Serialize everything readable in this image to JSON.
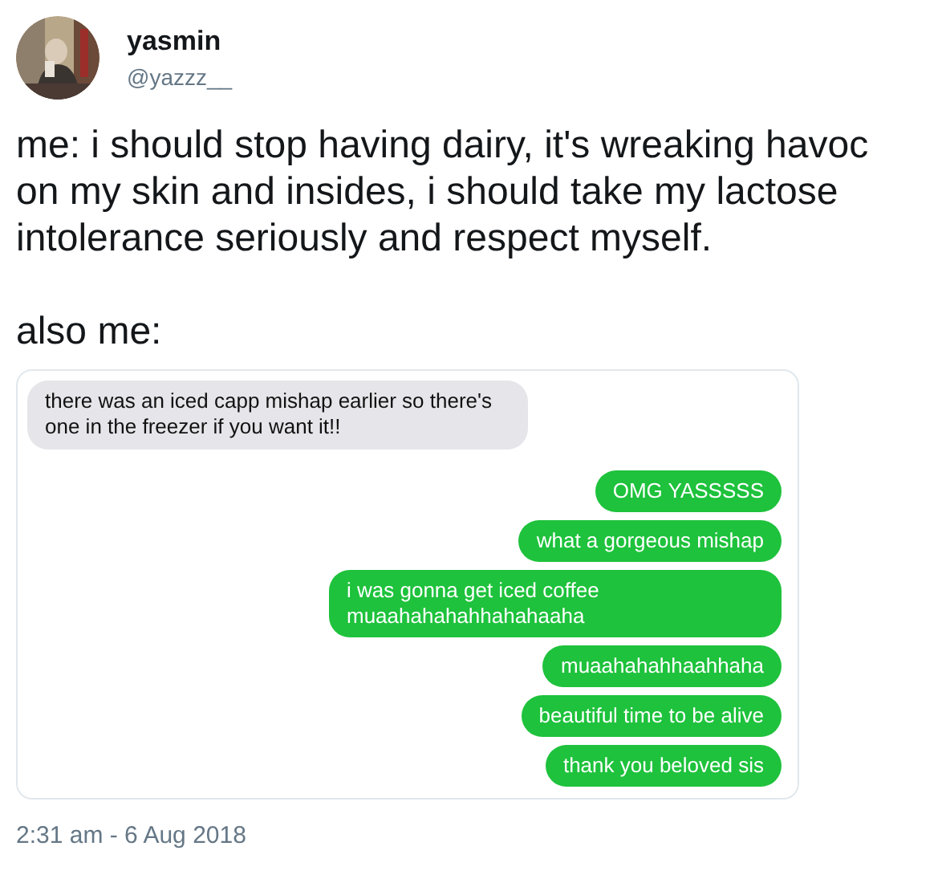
{
  "author": {
    "name": "yasmin",
    "handle": "@yazzz__"
  },
  "tweet": {
    "paragraphs": [
      "me: i should stop having dairy, it's wreaking havoc on my skin and insides, i should take my lactose intolerance seriously and respect myself.",
      "also me:"
    ]
  },
  "messages": [
    {
      "kind": "received",
      "text": "there was an iced capp mishap earlier so there's one in the freezer if you want it!!"
    },
    {
      "kind": "sent",
      "text": "OMG YASSSSS"
    },
    {
      "kind": "sent",
      "text": "what a gorgeous mishap"
    },
    {
      "kind": "sent",
      "text": "i was gonna get iced coffee muaahahahahhahahaaha"
    },
    {
      "kind": "sent",
      "text": "muaahahahhaahhaha"
    },
    {
      "kind": "sent",
      "text": "beautiful time to be alive"
    },
    {
      "kind": "sent",
      "text": "thank you beloved sis"
    }
  ],
  "timestamp": "2:31 am - 6 Aug 2018"
}
